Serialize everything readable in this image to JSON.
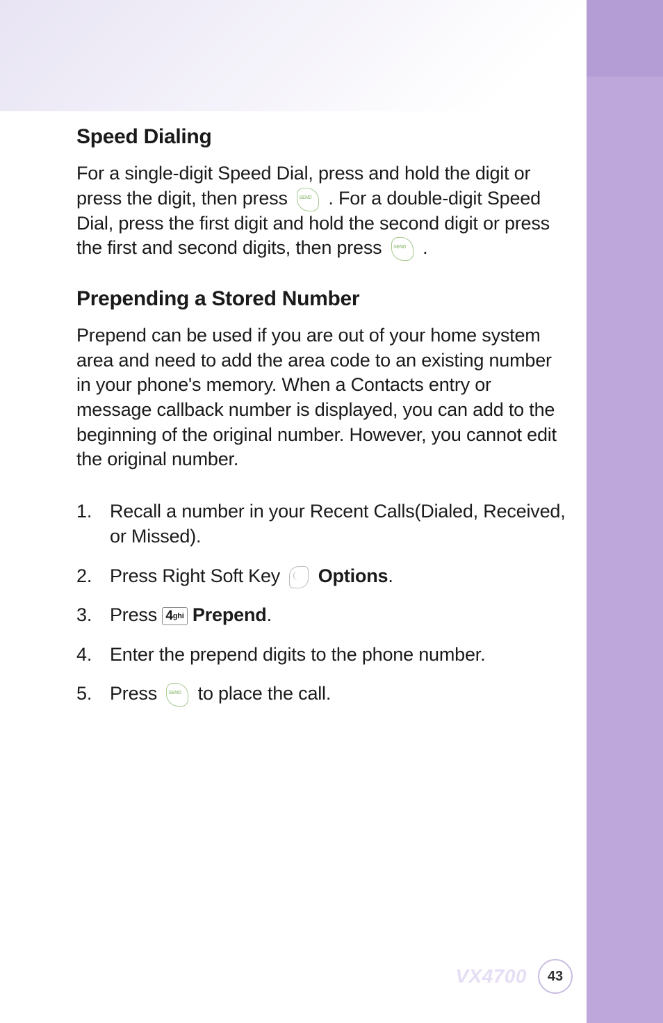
{
  "sections": {
    "speed_dialing": {
      "heading": "Speed Dialing",
      "para_part1": "For a single-digit Speed Dial, press and hold the digit or press the digit, then press ",
      "para_part2": " . For a double-digit Speed Dial, press the first digit and hold the second digit or press the first and second digits, then press ",
      "para_part3": " ."
    },
    "prepending": {
      "heading": "Prepending a Stored Number",
      "para": "Prepend can be used if you are out of your home system area and need to add the area code to an existing number in your phone's memory. When a Contacts entry or message callback number is displayed, you can add to the beginning of the original number. However, you cannot edit the original number.",
      "steps": [
        {
          "num": "1.",
          "pre": "Recall a number in your Recent Calls(Dialed, Received, or Missed)."
        },
        {
          "num": "2.",
          "pre": "Press Right Soft Key ",
          "bold": "Options",
          "post": "."
        },
        {
          "num": "3.",
          "pre": "Press ",
          "bold": "Prepend",
          "post": "."
        },
        {
          "num": "4.",
          "pre": "Enter the prepend digits to the phone number."
        },
        {
          "num": "5.",
          "pre": "Press ",
          "post": "  to place the call."
        }
      ]
    }
  },
  "key4_label": "4",
  "key4_sub": "ghi",
  "footer": {
    "model": "VX4700",
    "page": "43"
  }
}
